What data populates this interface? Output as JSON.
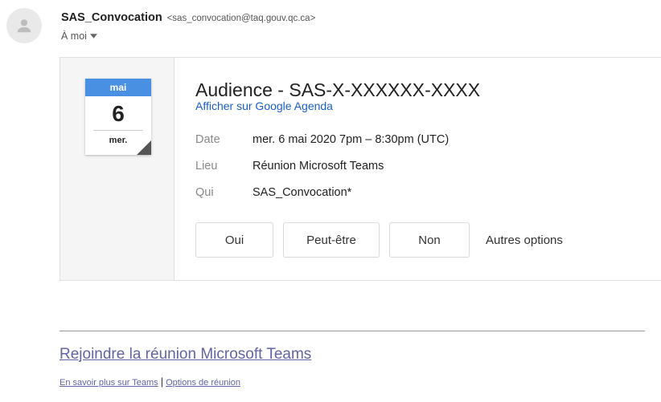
{
  "sender": {
    "name": "SAS_Convocation",
    "email": "<sas_convocation@taq.gouv.qc.ca>",
    "recipient": "À moi"
  },
  "calendar": {
    "month": "mai",
    "day": "6",
    "weekday": "mer."
  },
  "event": {
    "title": "Audience - SAS-X-XXXXXX-XXXX",
    "gcal_link": "Afficher sur Google Agenda",
    "details": [
      {
        "label": "Date",
        "value": "mer. 6 mai 2020 7pm – 8:30pm (UTC)"
      },
      {
        "label": "Lieu",
        "value": "Réunion Microsoft Teams"
      },
      {
        "label": "Qui",
        "value": "SAS_Convocation*"
      }
    ]
  },
  "rsvp": {
    "yes": "Oui",
    "maybe": "Peut-être",
    "no": "Non",
    "more": "Autres options"
  },
  "teams": {
    "join": "Rejoindre la réunion Microsoft Teams",
    "learn_more": "En savoir plus sur Teams",
    "separator": "|",
    "options": "Options de réunion"
  },
  "colors": {
    "calendar_header": "#4a90e2",
    "gcal_link": "#1a5fcc",
    "teams_link": "#6264a7"
  }
}
